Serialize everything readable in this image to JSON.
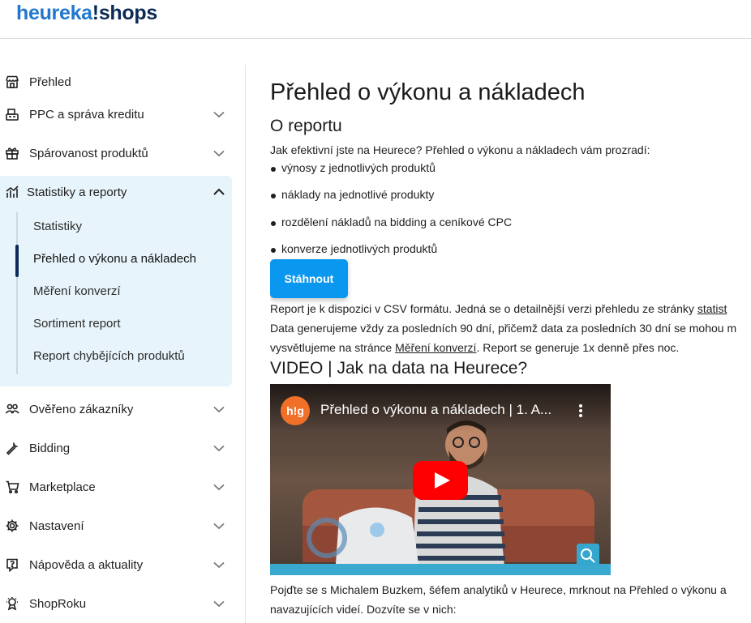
{
  "brand": {
    "logo_part1": "heureka",
    "logo_part2": "!shops"
  },
  "sidebar": {
    "items": [
      {
        "label": "Přehled",
        "icon": "store-icon"
      },
      {
        "label": "PPC a správa kreditu",
        "icon": "cash-register-icon"
      },
      {
        "label": "Spárovanost produktů",
        "icon": "gift-box-icon"
      },
      {
        "label": "Statistiky a reporty",
        "icon": "chart-icon"
      },
      {
        "label": "Ověřeno zákazníky",
        "icon": "users-icon"
      },
      {
        "label": "Bidding",
        "icon": "wrench-icon"
      },
      {
        "label": "Marketplace",
        "icon": "cart-icon"
      },
      {
        "label": "Nastavení",
        "icon": "gear-icon"
      },
      {
        "label": "Nápověda a aktuality",
        "icon": "help-icon"
      },
      {
        "label": "ShopRoku",
        "icon": "award-icon"
      }
    ],
    "subitems": [
      {
        "label": "Statistiky"
      },
      {
        "label": "Přehled o výkonu a nákladech"
      },
      {
        "label": "Měření konverzí"
      },
      {
        "label": "Sortiment report"
      },
      {
        "label": "Report chybějících produktů"
      }
    ]
  },
  "main": {
    "title": "Přehled o výkonu a nákladech",
    "about_heading": "O reportu",
    "intro": "Jak efektivní jste na Heurece? Přehled o výkonu a nákladech vám prozradí:",
    "bullets": [
      "výnosy z jednotlivých produktů",
      "náklady na jednotlivé produkty",
      "rozdělení nákladů na bidding a ceníkové CPC",
      "konverze jednotlivých produktů"
    ],
    "download_label": "Stáhnout",
    "info_line1_a": "Report je k dispozici v CSV formátu. Jedná se o detailnější verzi přehledu ze stránky ",
    "info_line1_link": "statist",
    "info_line2": "Data generujeme vždy za posledních 90 dní, přičemž data za posledních 30 dní se mohou m",
    "info_line3_a": "vysvětlujeme na stránce ",
    "info_line3_link": "Měření konverzí",
    "info_line3_b": ". Report se generuje 1x denně přes noc.",
    "video_heading": "VIDEO | Jak na data na Heurece?",
    "video_title": "Přehled o výkonu a nákladech | 1. A...",
    "video_channel_badge": "h!g",
    "outro_line1": "Pojďte se s Michalem Buzkem, šéfem analytiků v Heurece, mrknout na Přehled o výkonu a",
    "outro_line2": "navazujících videí. Dozvíte se v nich:"
  },
  "colors": {
    "accent": "#0a97f0",
    "brand_dark": "#0d2a57",
    "brand_blue": "#2277cc",
    "expanded_bg": "#e7f4fb",
    "youtube_red": "#ff0000"
  }
}
